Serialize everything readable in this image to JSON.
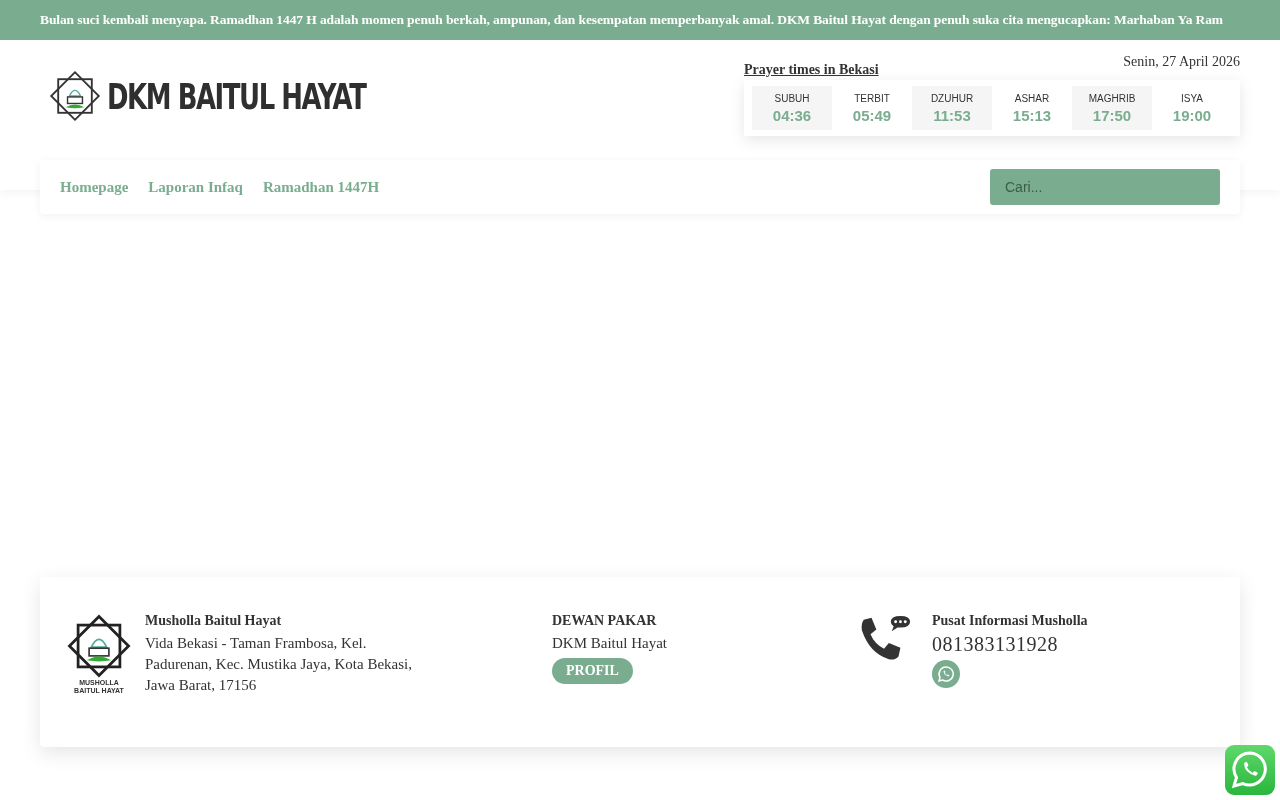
{
  "ticker": "Bulan suci kembali menyapa. Ramadhan 1447 H adalah momen penuh berkah, ampunan, dan kesempatan memperbanyak amal. DKM Baitul Hayat dengan penuh suka cita mengucapkan: Marhaban Ya Ram",
  "logo": {
    "text": "DKM BAITUL HAYAT"
  },
  "prayer": {
    "title": "Prayer times in Bekasi",
    "date": "Senin, 27 April 2026",
    "times": [
      {
        "name": "SUBUH",
        "time": "04:36"
      },
      {
        "name": "TERBIT",
        "time": "05:49"
      },
      {
        "name": "DZUHUR",
        "time": "11:53"
      },
      {
        "name": "ASHAR",
        "time": "15:13"
      },
      {
        "name": "MAGHRIB",
        "time": "17:50"
      },
      {
        "name": "ISYA",
        "time": "19:00"
      }
    ]
  },
  "nav": {
    "items": [
      "Homepage",
      "Laporan Infaq",
      "Ramadhan 1447H"
    ],
    "search": {
      "placeholder": "Cari..."
    }
  },
  "footer": {
    "logo_caption": [
      "MUSHOLLA",
      "BAITUL HAYAT"
    ],
    "about": {
      "title": "Musholla Baitul Hayat",
      "address": "Vida Bekasi - Taman Frambosa, Kel. Padurenan, Kec. Mustika Jaya, Kota Bekasi, Jawa Barat, 17156"
    },
    "board": {
      "title": "DEWAN PAKAR",
      "text": "DKM Baitul Hayat",
      "button": "PROFIL"
    },
    "contact": {
      "title": "Pusat Informasi Musholla",
      "phone": "081383131928"
    }
  }
}
